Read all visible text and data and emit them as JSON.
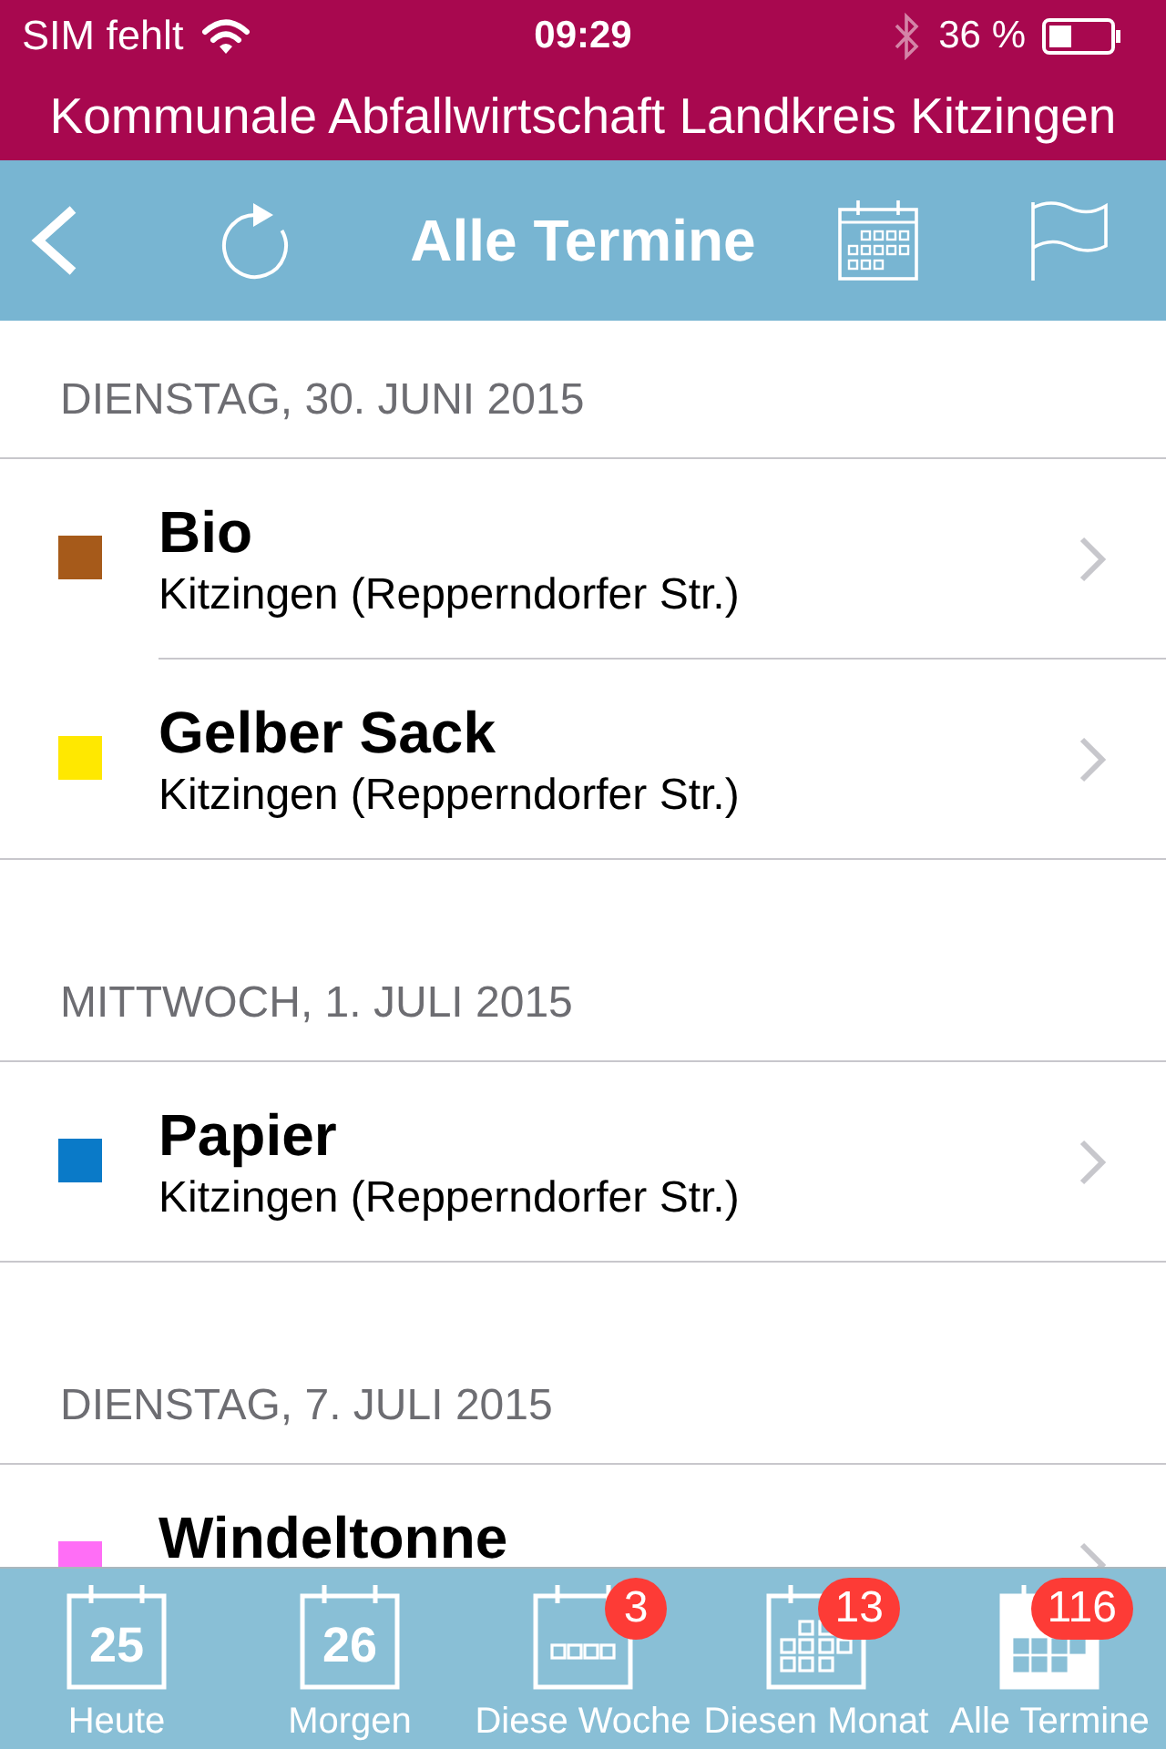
{
  "status_bar": {
    "carrier": "SIM fehlt",
    "time": "09:29",
    "battery": "36 %"
  },
  "app_header": {
    "title": "Kommunale Abfallwirtschaft Landkreis Kitzingen"
  },
  "nav_bar": {
    "title": "Alle Termine"
  },
  "sections": [
    {
      "header": "DIENSTAG, 30. JUNI 2015",
      "items": [
        {
          "title": "Bio",
          "subtitle": "Kitzingen (Repperndorfer Str.)",
          "color": "#a65a1a"
        },
        {
          "title": "Gelber Sack",
          "subtitle": "Kitzingen (Repperndorfer Str.)",
          "color": "#ffe800"
        }
      ]
    },
    {
      "header": "MITTWOCH, 1. JULI 2015",
      "items": [
        {
          "title": "Papier",
          "subtitle": "Kitzingen (Repperndorfer Str.)",
          "color": "#0a7ac8"
        }
      ]
    },
    {
      "header": "DIENSTAG, 7. JULI 2015",
      "items": [
        {
          "title": "Windeltonne",
          "color": "#ff6ef6"
        }
      ]
    }
  ],
  "tab_bar": {
    "tabs": [
      {
        "label": "Heute",
        "kind": "day",
        "date": "25",
        "selected": false
      },
      {
        "label": "Morgen",
        "kind": "day",
        "date": "26",
        "selected": false
      },
      {
        "label": "Diese Woche",
        "kind": "week",
        "badge": "3",
        "selected": false
      },
      {
        "label": "Diesen Monat",
        "kind": "month",
        "badge": "13",
        "selected": false
      },
      {
        "label": "Alle Termine",
        "kind": "all",
        "badge": "116",
        "selected": true
      }
    ]
  }
}
